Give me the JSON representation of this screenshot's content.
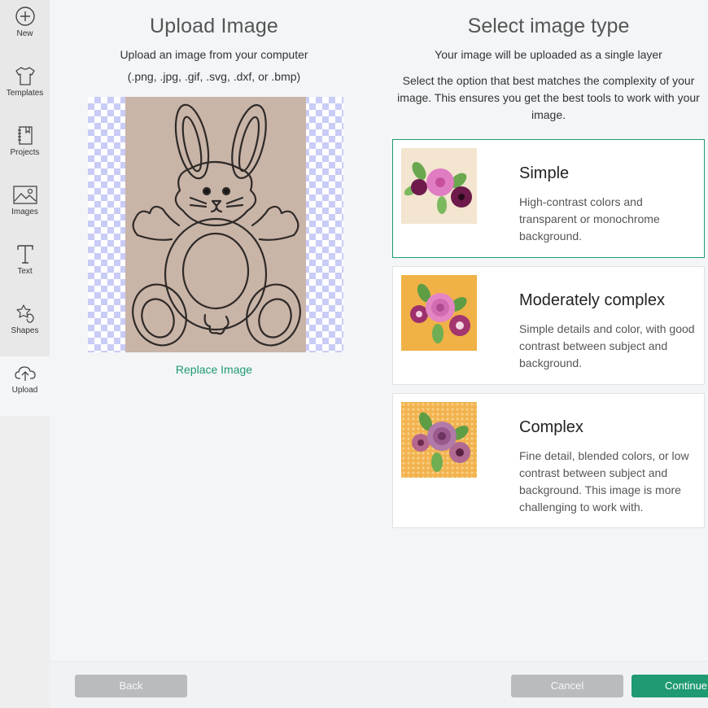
{
  "sidebar": {
    "items": [
      {
        "label": "New",
        "icon": "plus-circle-icon"
      },
      {
        "label": "Templates",
        "icon": "tshirt-icon"
      },
      {
        "label": "Projects",
        "icon": "notebook-icon"
      },
      {
        "label": "Images",
        "icon": "picture-icon"
      },
      {
        "label": "Text",
        "icon": "text-t-icon"
      },
      {
        "label": "Shapes",
        "icon": "shapes-icon"
      },
      {
        "label": "Upload",
        "icon": "cloud-upload-icon",
        "active": true
      }
    ]
  },
  "upload": {
    "title": "Upload Image",
    "subtitle_line1": "Upload an image from your computer",
    "subtitle_line2": "(.png, .jpg, .gif, .svg, .dxf, or .bmp)",
    "replace_label": "Replace Image"
  },
  "image_type": {
    "title": "Select image type",
    "subtitle": "Your image will be uploaded as a single layer",
    "description": "Select the option that best matches the complexity of your image. This ensures you get the best tools to work with your image.",
    "options": [
      {
        "name": "Simple",
        "description": "High-contrast colors and transparent or monochrome background.",
        "selected": true
      },
      {
        "name": "Moderately complex",
        "description": "Simple details and color, with good contrast between subject and background.",
        "selected": false
      },
      {
        "name": "Complex",
        "description": "Fine detail, blended colors, or low contrast between subject and background. This image is more challenging to work with.",
        "selected": false
      }
    ]
  },
  "footer": {
    "back_label": "Back",
    "cancel_label": "Cancel",
    "continue_label": "Continue"
  },
  "colors": {
    "accent": "#1f9a72",
    "disabled_button": "#b9bbbe",
    "checker": "#c9ccf6"
  }
}
